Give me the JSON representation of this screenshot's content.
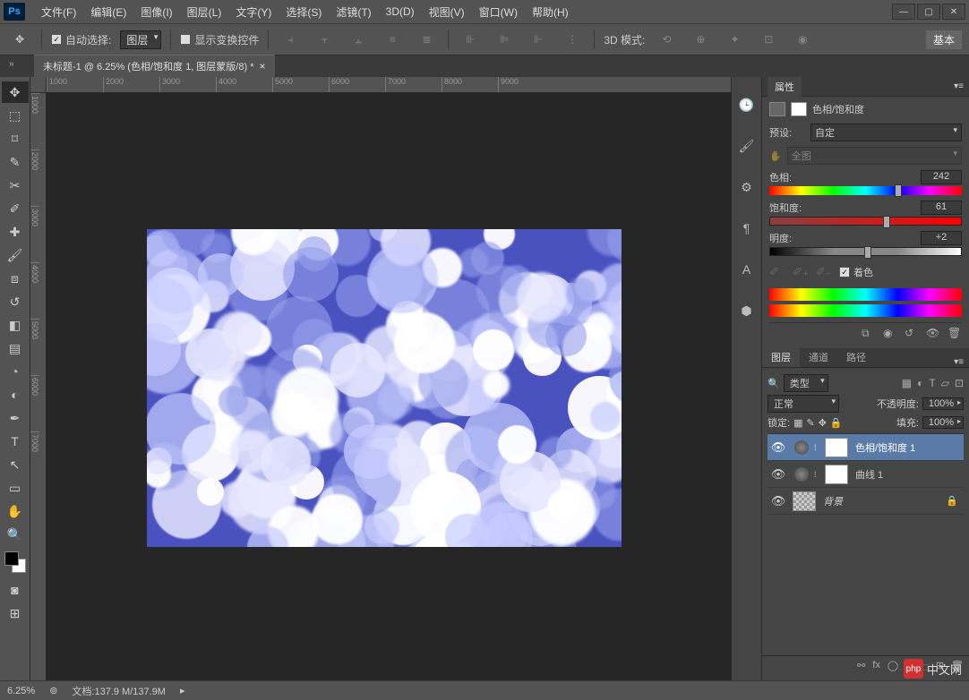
{
  "menu": {
    "items": [
      "文件(F)",
      "编辑(E)",
      "图像(I)",
      "图层(L)",
      "文字(Y)",
      "选择(S)",
      "滤镜(T)",
      "3D(D)",
      "视图(V)",
      "窗口(W)",
      "帮助(H)"
    ]
  },
  "window_controls": {
    "min": "—",
    "max": "▢",
    "close": "✕"
  },
  "options": {
    "auto_select": "自动选择:",
    "target": "图层",
    "show_transform": "显示变换控件",
    "mode_3d": "3D 模式:",
    "right_button": "基本"
  },
  "tab": {
    "title": "未标题-1 @ 6.25% (色相/饱和度 1, 图层蒙版/8) *"
  },
  "ruler_h": [
    "1000",
    "2000",
    "3000",
    "4000",
    "5000",
    "6000",
    "7000",
    "8000",
    "9000"
  ],
  "ruler_v": [
    "1000",
    "2000",
    "3000",
    "4000",
    "5000",
    "6000",
    "7000"
  ],
  "properties": {
    "panel_label": "属性",
    "adj_name": "色相/饱和度",
    "preset_label": "预设:",
    "preset_value": "自定",
    "range_value": "全图",
    "hue_label": "色相:",
    "hue_value": "242",
    "sat_label": "饱和度:",
    "sat_value": "61",
    "light_label": "明度:",
    "light_value": "+2",
    "colorize": "着色"
  },
  "layers": {
    "tabs": [
      "图层",
      "通道",
      "路径"
    ],
    "kind_label": "类型",
    "blend": "正常",
    "opacity_label": "不透明度:",
    "opacity_value": "100%",
    "lock_label": "锁定:",
    "fill_label": "填充:",
    "fill_value": "100%",
    "items": [
      {
        "name": "色相/饱和度 1",
        "type": "adj",
        "selected": true
      },
      {
        "name": "曲线 1",
        "type": "adj",
        "selected": false
      },
      {
        "name": "背景",
        "type": "bg",
        "selected": false
      }
    ]
  },
  "status": {
    "zoom": "6.25%",
    "doc": "文档:137.9 M/137.9M"
  },
  "watermark": "中文网"
}
